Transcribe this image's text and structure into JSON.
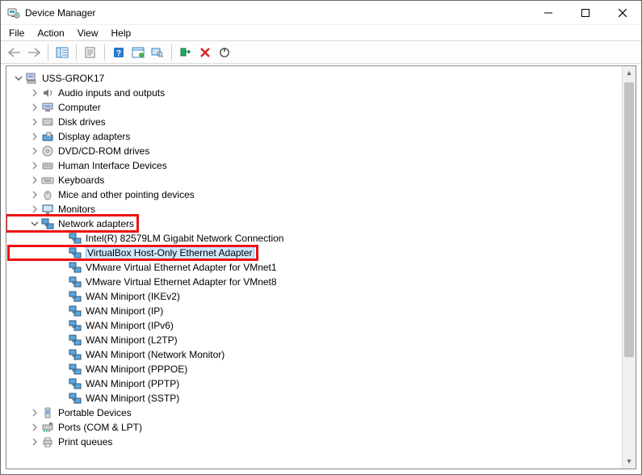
{
  "window": {
    "title": "Device Manager"
  },
  "menu": {
    "file": "File",
    "action": "Action",
    "view": "View",
    "help": "Help"
  },
  "tree": {
    "root": "USS-GROK17",
    "categories": [
      {
        "label": "Audio inputs and outputs",
        "icon": "audio",
        "expanded": false,
        "children": []
      },
      {
        "label": "Computer",
        "icon": "computer",
        "expanded": false,
        "children": []
      },
      {
        "label": "Disk drives",
        "icon": "disk",
        "expanded": false,
        "children": []
      },
      {
        "label": "Display adapters",
        "icon": "display",
        "expanded": false,
        "children": []
      },
      {
        "label": "DVD/CD-ROM drives",
        "icon": "dvd",
        "expanded": false,
        "children": []
      },
      {
        "label": "Human Interface Devices",
        "icon": "hid",
        "expanded": false,
        "children": []
      },
      {
        "label": "Keyboards",
        "icon": "keyboard",
        "expanded": false,
        "children": []
      },
      {
        "label": "Mice and other pointing devices",
        "icon": "mouse",
        "expanded": false,
        "children": []
      },
      {
        "label": "Monitors",
        "icon": "monitor",
        "expanded": false,
        "children": []
      },
      {
        "label": "Network adapters",
        "icon": "network",
        "expanded": true,
        "highlight": true,
        "children": [
          {
            "label": "Intel(R) 82579LM Gigabit Network Connection",
            "icon": "network"
          },
          {
            "label": "VirtualBox Host-Only Ethernet Adapter",
            "icon": "network",
            "selected": true,
            "highlight": true
          },
          {
            "label": "VMware Virtual Ethernet Adapter for VMnet1",
            "icon": "network"
          },
          {
            "label": "VMware Virtual Ethernet Adapter for VMnet8",
            "icon": "network"
          },
          {
            "label": "WAN Miniport (IKEv2)",
            "icon": "network"
          },
          {
            "label": "WAN Miniport (IP)",
            "icon": "network"
          },
          {
            "label": "WAN Miniport (IPv6)",
            "icon": "network"
          },
          {
            "label": "WAN Miniport (L2TP)",
            "icon": "network"
          },
          {
            "label": "WAN Miniport (Network Monitor)",
            "icon": "network"
          },
          {
            "label": "WAN Miniport (PPPOE)",
            "icon": "network"
          },
          {
            "label": "WAN Miniport (PPTP)",
            "icon": "network"
          },
          {
            "label": "WAN Miniport (SSTP)",
            "icon": "network"
          }
        ]
      },
      {
        "label": "Portable Devices",
        "icon": "portable",
        "expanded": false,
        "children": []
      },
      {
        "label": "Ports (COM & LPT)",
        "icon": "port",
        "expanded": false,
        "children": []
      },
      {
        "label": "Print queues",
        "icon": "printer",
        "expanded": false,
        "children": []
      }
    ]
  }
}
